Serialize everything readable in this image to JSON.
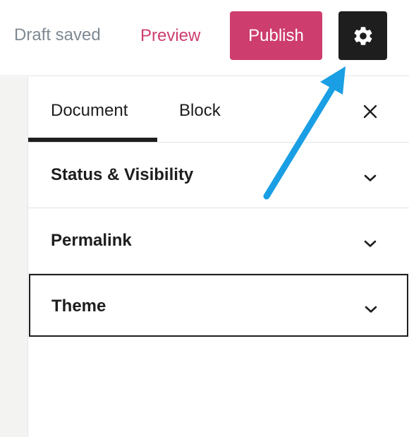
{
  "toolbar": {
    "draft_status": "Draft saved",
    "preview_label": "Preview",
    "publish_label": "Publish",
    "settings_icon": "gear-icon"
  },
  "sidebar": {
    "tabs": [
      {
        "label": "Document",
        "active": true
      },
      {
        "label": "Block",
        "active": false
      }
    ],
    "close_icon": "close-icon",
    "panels": [
      {
        "title": "Status & Visibility",
        "icon": "chevron-down-icon"
      },
      {
        "title": "Permalink",
        "icon": "chevron-down-icon"
      },
      {
        "title": "Theme",
        "icon": "chevron-down-icon",
        "focused": true
      }
    ]
  },
  "annotation": {
    "arrow_color": "#1a9fe4",
    "points_to": "settings-button"
  },
  "colors": {
    "accent": "#cd3d6d",
    "dark": "#1e1e1e",
    "muted_text": "#7e8993"
  }
}
